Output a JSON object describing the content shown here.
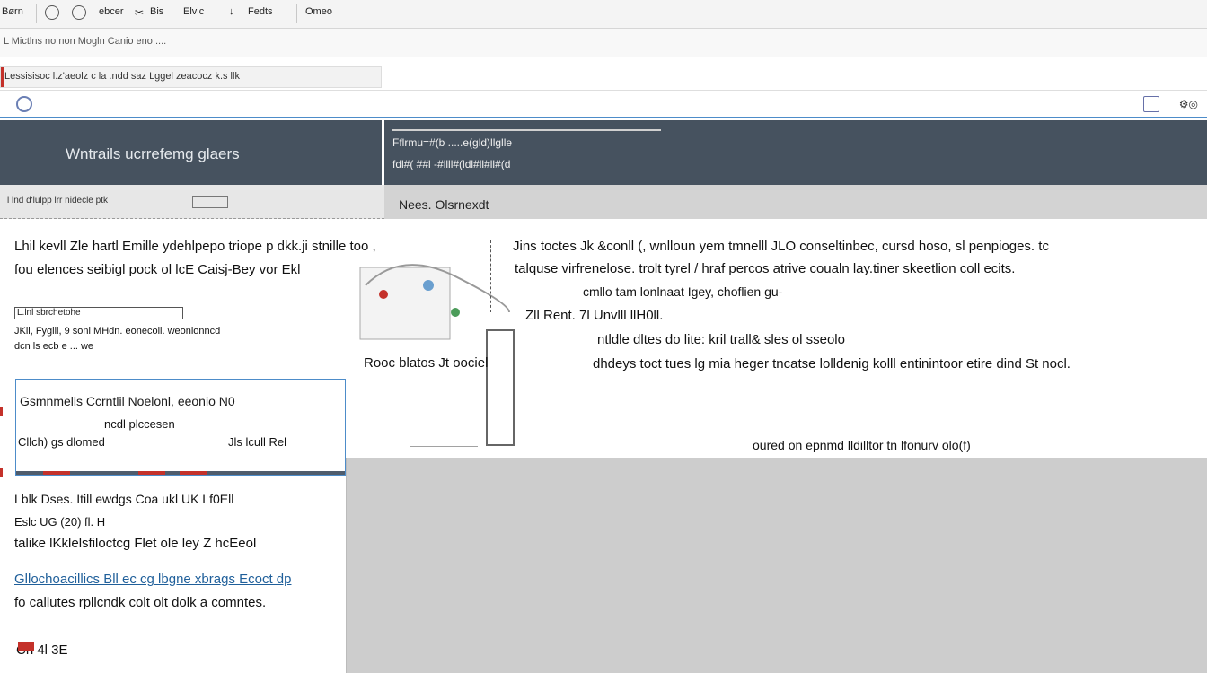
{
  "toolbar": {
    "items": [
      "Børn",
      "ebcer",
      "Bis",
      "Elvic",
      "Fedts",
      "Omeo"
    ]
  },
  "subbar": {
    "text": "L Mictlns no non Mogln Canio eno ...."
  },
  "breadcrumb": {
    "text": "Lessisisoc l.z'aeolz c la .ndd saz Lggel zeacocz k.s llk"
  },
  "header": {
    "left_title": "Wntrails ucrrefemg glaers",
    "right_line1": "Fflrmu=#(b .....e(gld)llglle",
    "right_line2": "fdl#( ##l -#llll#(ldl#ll#ll#(d"
  },
  "band": {
    "left_text": "l lnd d'lulpp lrr nidecle ptk",
    "right_text": "Nees. Olsrnexdt"
  },
  "content": {
    "left_para1": "Lhil kevll Zle hartl Emille ydehlpepo triope p dkk.ji stnille too ,",
    "left_para2": "fou elences seibigl pock ol lcE Caisj-Bey vor Ekl",
    "field_label": "L.lnl sbrchetohe",
    "left_small1": "JKll, Fyglll, 9 sonl MHdn. eonecoll. weonlonncd",
    "left_small2": "dcn ls ecb e ... we",
    "figure_caption": "Rooc blatos Jt oociel",
    "right_para1": "Jins toctes Jk &conll (, wnlloun yem tmnelll JLO conseltinbec, cursd hoso, sl penpioges. tc",
    "right_para2": "talquse virfrenelose. trolt tyrel / hraf percos atrive coualn lay.tiner skeetlion coll ecits.",
    "right_para3": "cmllo tam lonlnaat Igey, choflien gu-",
    "right_para4": "Zll Rent. 7l Unvlll llH0ll.",
    "right_para5": "ntldle dltes do lite: kril trall& sles ol sseolo",
    "right_para6": "dhdeys toct tues lg mia heger tncatse lolldenig kolll entinintoor etire dind St nocl.",
    "right_footer": "oured on epnmd lldilltor tn lfonurv olo(f)"
  },
  "card": {
    "title": "Gsmnmells  Ccrntlil   Noelonl, eeonio N0",
    "sub": "ncdl plccesen",
    "row_left": "Cllch) gs dlomed",
    "row_right": "Jls lcull Rel"
  },
  "leftpanel": {
    "line1": "Lblk Dses. Itill ewdgs Coa ukl UK Lf0Ell",
    "line2": "Eslc UG (20) fl. H",
    "line3": "talike lKklelsfiloctcg Flet ole ley Z hcEeol",
    "link": "Gllochoacillics Bll ec cg lbgne xbrags Ecoct dp",
    "line4": "fo callutes rpllcndk colt olt dolk a comntes.",
    "line5": "Ch 4l 3E"
  }
}
